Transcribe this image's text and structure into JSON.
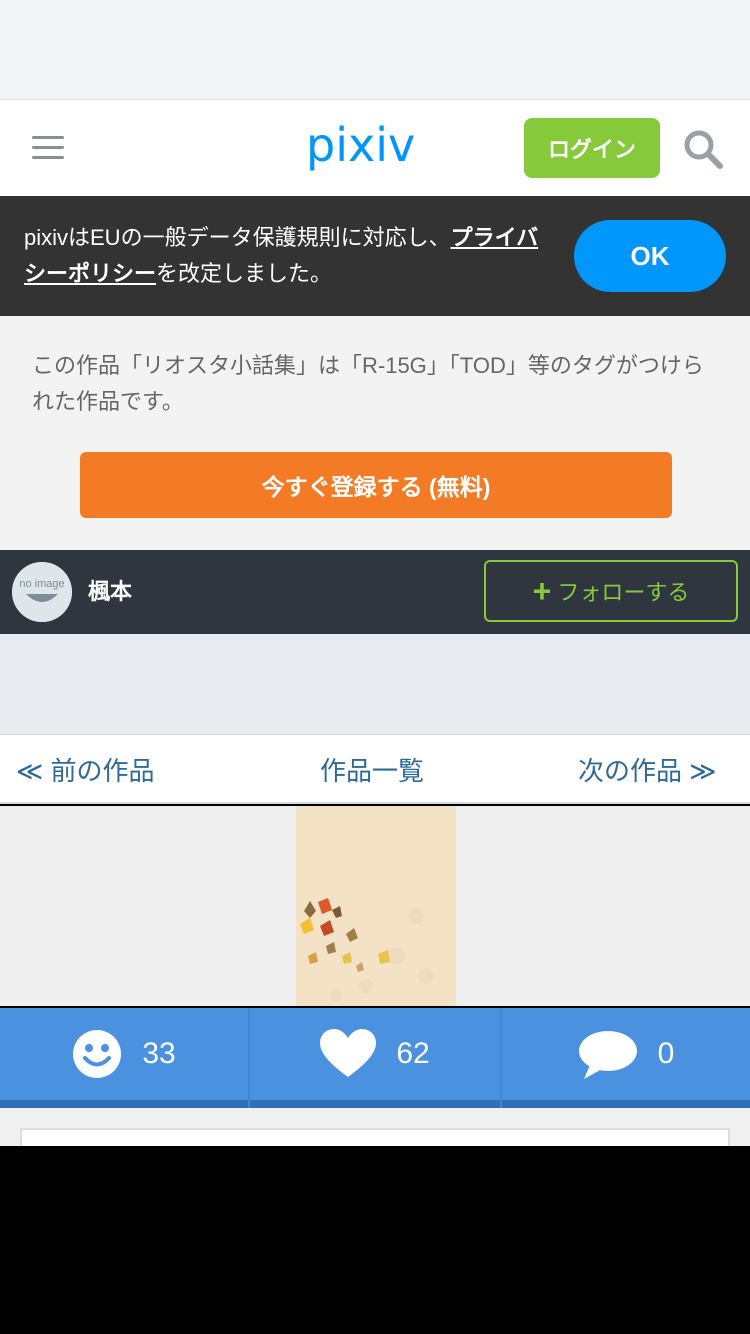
{
  "header": {
    "logo": "pixiv",
    "login_label": "ログイン",
    "icons": [
      "menu-icon",
      "search-icon"
    ]
  },
  "gdpr": {
    "text_before": "pixivはEUの一般データ保護規則に対応し、",
    "link": "プライバシーポリシー",
    "text_after": "を改定しました。",
    "ok_label": "OK"
  },
  "intro": {
    "text": "この作品「リオスタ小話集」は「R-15G」「TOD」等のタグがつけられた作品です。",
    "register_label": "今すぐ登録する (無料)"
  },
  "user": {
    "name": "楓本",
    "avatar_text": "no image",
    "follow_plus": "+",
    "follow_label": "フォローする"
  },
  "nav": {
    "prev": "≪ 前の作品",
    "list": "作品一覧",
    "next": "次の作品 ≫"
  },
  "stats": {
    "views": "33",
    "likes": "62",
    "comments": "0"
  },
  "colors": {
    "brand": "#0096fa",
    "login": "#86c93a",
    "register": "#f47b25",
    "stats_bg": "#4a92e0"
  }
}
